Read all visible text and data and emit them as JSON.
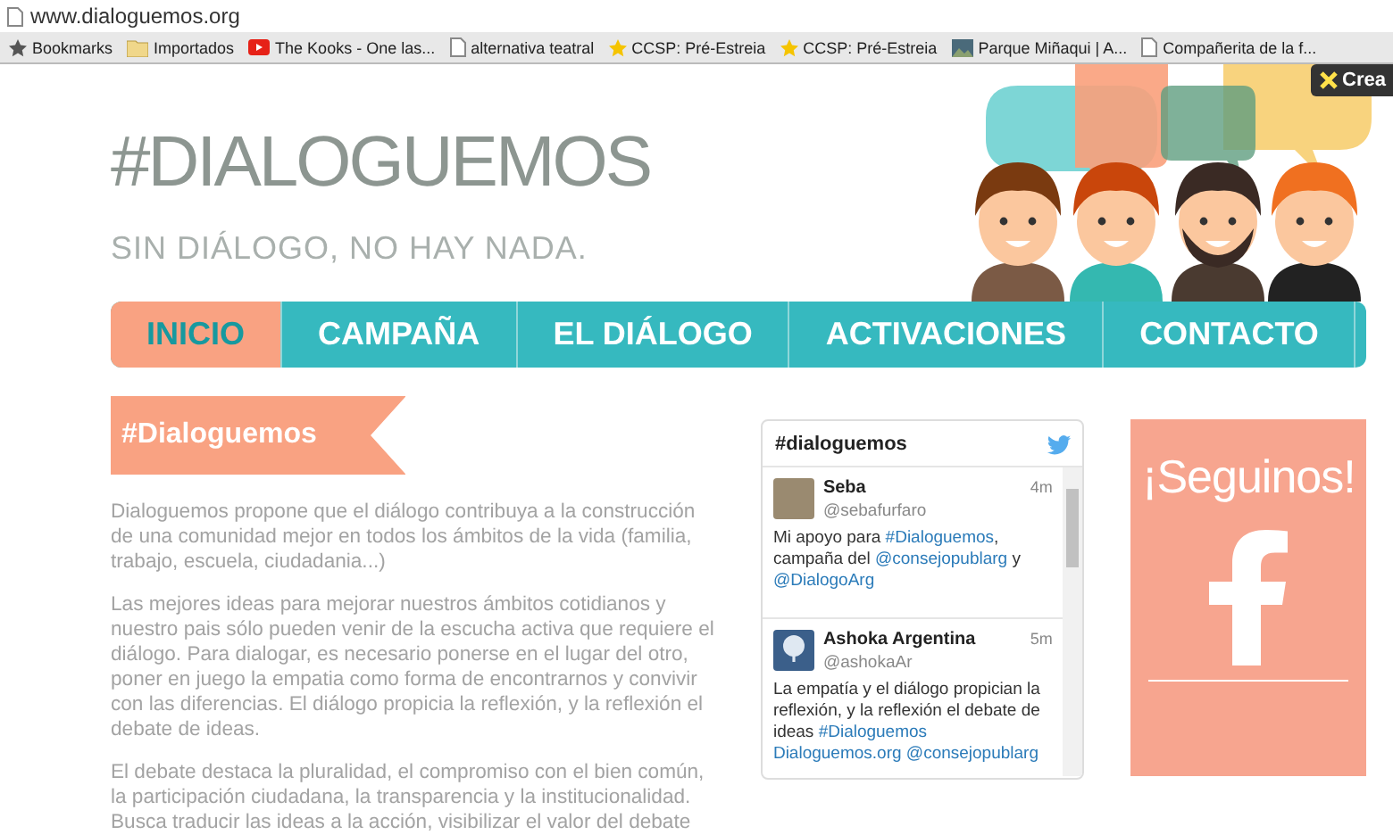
{
  "browser": {
    "url": "www.dialoguemos.org",
    "bookmarks": [
      {
        "label": "Bookmarks",
        "kind": "bookmarks"
      },
      {
        "label": "Importados",
        "kind": "folder"
      },
      {
        "label": "The Kooks - One las...",
        "kind": "video"
      },
      {
        "label": "alternativa teatral",
        "kind": "page"
      },
      {
        "label": "CCSP: Pré-Estreia",
        "kind": "star"
      },
      {
        "label": "CCSP: Pré-Estreia",
        "kind": "star"
      },
      {
        "label": "Parque Miñaqui | A...",
        "kind": "image"
      },
      {
        "label": "Compañerita de la f...",
        "kind": "page"
      }
    ],
    "extension_badge": "Crea"
  },
  "header": {
    "title": "#DIALOGUEMOS",
    "tagline": "SIN DIÁLOGO, NO HAY NADA."
  },
  "nav": [
    {
      "label": "INICIO",
      "selected": true
    },
    {
      "label": "CAMPAÑA",
      "selected": false
    },
    {
      "label": "EL DIÁLOGO",
      "selected": false
    },
    {
      "label": "ACTIVACIONES",
      "selected": false
    },
    {
      "label": "CONTACTO",
      "selected": false
    }
  ],
  "section_banner": "#Dialoguemos",
  "paragraphs": [
    "Dialoguemos propone que el diálogo contribuya a la construcción de una comunidad mejor en todos los ámbitos de la vida (familia, trabajo, escuela, ciudadania...)",
    "Las mejores ideas para mejorar nuestros ámbitos cotidianos y nuestro pais sólo pueden venir de la escucha activa que requiere el diálogo. Para dialogar, es necesario ponerse en el lugar del otro, poner en juego la empatia como forma de encontrarnos y convivir con las diferencias. El diálogo propicia la reflexión, y la reflexión el debate de ideas.",
    "El debate destaca la pluralidad, el compromiso con el bien común, la participación ciudadana, la transparencia y la institucionalidad. Busca traducir las ideas a la acción, visibilizar el valor del debate"
  ],
  "twitter": {
    "title": "#dialoguemos",
    "tweets": [
      {
        "name": "Seba",
        "handle": "@sebafurfaro",
        "time": "4m",
        "kind": "photo",
        "parts": [
          {
            "text": "Mi apoyo para ",
            "kind": "text"
          },
          {
            "text": "#Dialoguemos",
            "kind": "link"
          },
          {
            "text": ", campaña del ",
            "kind": "text"
          },
          {
            "text": "@consejopublarg",
            "kind": "link"
          },
          {
            "text": " y ",
            "kind": "text"
          },
          {
            "text": "@DialogoArg",
            "kind": "link"
          }
        ]
      },
      {
        "name": "Ashoka Argentina",
        "handle": "@ashokaAr",
        "time": "5m",
        "kind": "logo",
        "parts": [
          {
            "text": "La empatía y el diálogo propician la reflexión, y la reflexión el debate de ideas ",
            "kind": "text"
          },
          {
            "text": "#Dialoguemos ",
            "kind": "link"
          },
          {
            "text": "Dialoguemos.org ",
            "kind": "link"
          },
          {
            "text": "@consejopublarg",
            "kind": "link"
          }
        ]
      }
    ]
  },
  "follow": {
    "title": "¡Seguinos!"
  }
}
